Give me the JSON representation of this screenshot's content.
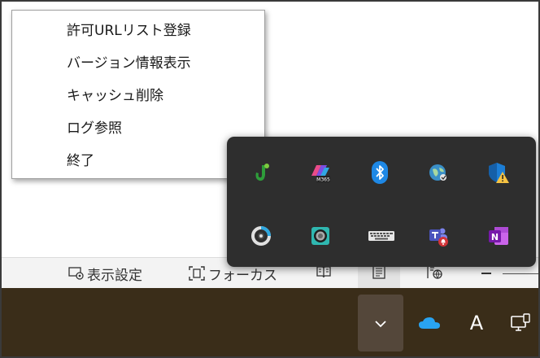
{
  "context_menu": {
    "items": [
      {
        "label": "許可URLリスト登録"
      },
      {
        "label": "バージョン情報表示"
      },
      {
        "label": "キャッシュ削除"
      },
      {
        "label": "ログ参照"
      },
      {
        "label": "終了"
      }
    ]
  },
  "status_bar": {
    "display_settings_label": "表示設定",
    "focus_label": "フォーカス"
  },
  "tray_flyout": {
    "icons": [
      {
        "name": "green-j-app-icon"
      },
      {
        "name": "microsoft-365-copilot-icon",
        "badge": "M365"
      },
      {
        "name": "bluetooth-icon"
      },
      {
        "name": "network-globe-icon"
      },
      {
        "name": "windows-security-warning-icon"
      },
      {
        "name": "circular-sync-app-icon"
      },
      {
        "name": "screen-capture-icon"
      },
      {
        "name": "keyboard-icon"
      },
      {
        "name": "teams-notification-icon"
      },
      {
        "name": "onenote-icon",
        "letter": "N"
      }
    ]
  },
  "taskbar": {
    "ime_label": "A",
    "accent": "#3a2d19"
  }
}
